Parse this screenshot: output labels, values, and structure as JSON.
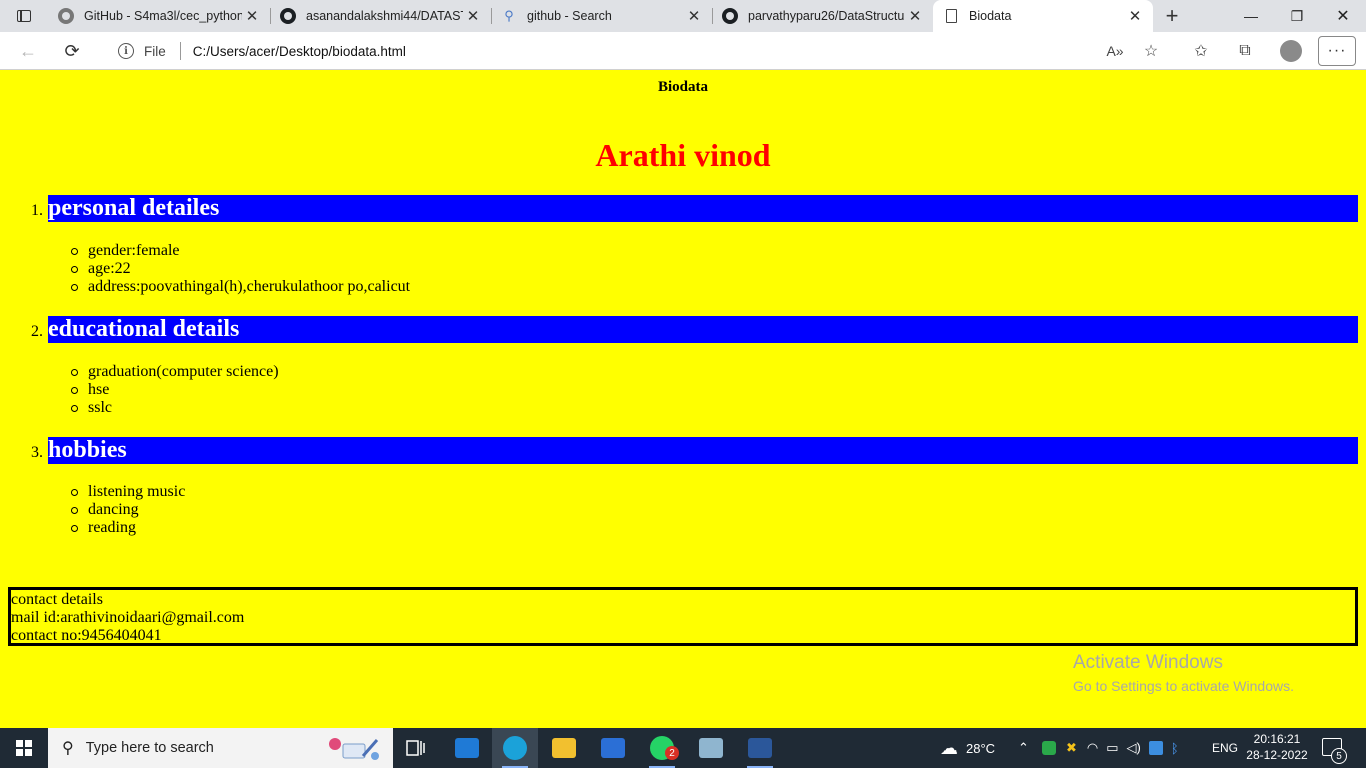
{
  "browser": {
    "tabs": [
      {
        "title": "GitHub - S4ma3l/cec_python_",
        "favicon": "github-icon",
        "active": false
      },
      {
        "title": "asanandalakshmi44/DATASTR",
        "favicon": "github-icon",
        "active": false
      },
      {
        "title": "github - Search",
        "favicon": "search-icon",
        "active": false
      },
      {
        "title": "parvathyparu26/DataStructur",
        "favicon": "github-icon",
        "active": false
      },
      {
        "title": "Biodata",
        "favicon": "document-icon",
        "active": true
      }
    ],
    "address_bar": {
      "scheme_label": "File",
      "url": "C:/Users/acer/Desktop/biodata.html"
    }
  },
  "page": {
    "doc_title": "Biodata",
    "name": "Arathi vinod",
    "name_color": "#ff0000",
    "background_color": "#ffff00",
    "section_bar_color": "#0000ff",
    "sections": [
      {
        "number": "1.",
        "heading": "personal detailes",
        "items": [
          "gender:female",
          "age:22",
          "address:poovathingal(h),cherukulathoor po,calicut"
        ]
      },
      {
        "number": "2.",
        "heading": "educational details",
        "items": [
          "graduation(computer science)",
          "hse",
          "sslc"
        ]
      },
      {
        "number": "3.",
        "heading": "hobbies",
        "items": [
          "listening music",
          "dancing",
          "reading"
        ]
      }
    ],
    "contact": {
      "title": "contact details",
      "mail": "mail id:arathivinoidaari@gmail.com",
      "phone": "contact no:9456404041"
    },
    "watermark": {
      "title": "Activate Windows",
      "subtitle": "Go to Settings to activate Windows."
    }
  },
  "taskbar": {
    "search_placeholder": "Type here to search",
    "weather": "28°C",
    "language": "ENG",
    "time": "20:16:21",
    "date": "28-12-2022",
    "whatsapp_badge": "2",
    "notification_count": "5"
  }
}
